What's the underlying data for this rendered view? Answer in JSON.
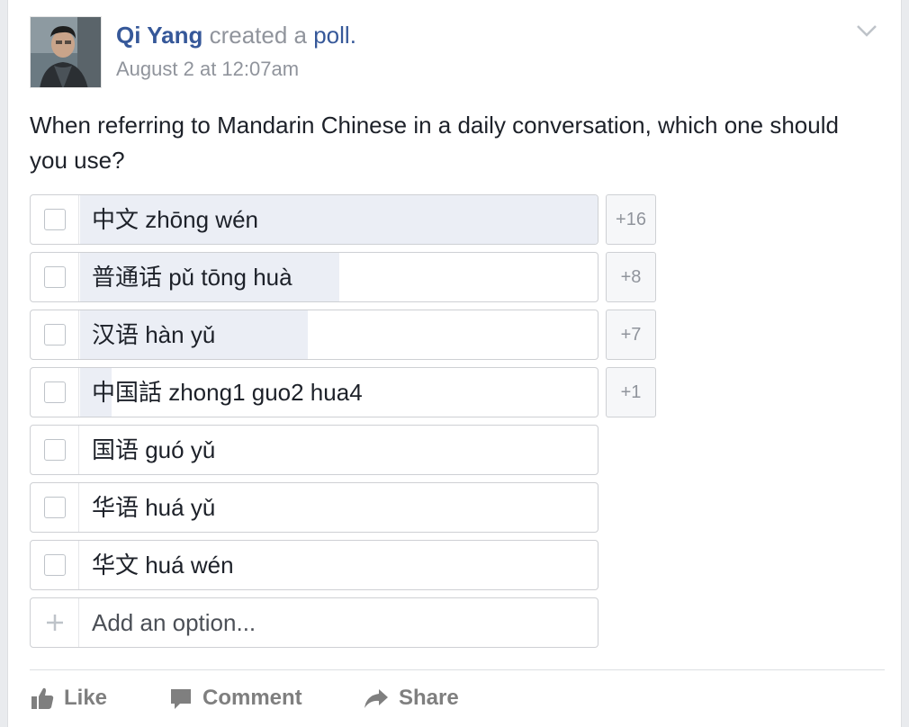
{
  "post": {
    "author": "Qi Yang",
    "verb": "created a",
    "object": "poll.",
    "timestamp": "August 2 at 12:07am",
    "question": "When referring to Mandarin Chinese in a daily conversation, which one should you use?"
  },
  "poll": {
    "options": [
      {
        "label": "中文 zhōng wén",
        "votes": "+16",
        "fill_fraction": 1.0
      },
      {
        "label": "普通话 pǔ tōng huà",
        "votes": "+8",
        "fill_fraction": 0.5
      },
      {
        "label": "汉语 hàn yǔ",
        "votes": "+7",
        "fill_fraction": 0.44
      },
      {
        "label": "中国話 zhong1 guo2 hua4",
        "votes": "+1",
        "fill_fraction": 0.06
      },
      {
        "label": "国语 guó yǔ",
        "votes": "",
        "fill_fraction": 0
      },
      {
        "label": "华语 huá yǔ",
        "votes": "",
        "fill_fraction": 0
      },
      {
        "label": "华文 huá wén",
        "votes": "",
        "fill_fraction": 0
      }
    ],
    "add_option_placeholder": "Add an option..."
  },
  "actions": {
    "like": "Like",
    "comment": "Comment",
    "share": "Share"
  },
  "colors": {
    "link": "#365899",
    "muted": "#90949c",
    "bar_fill": "#ebeef5"
  },
  "icons": [
    "avatar",
    "chevron-down-icon",
    "plus-icon",
    "like-icon",
    "comment-icon",
    "share-icon"
  ]
}
